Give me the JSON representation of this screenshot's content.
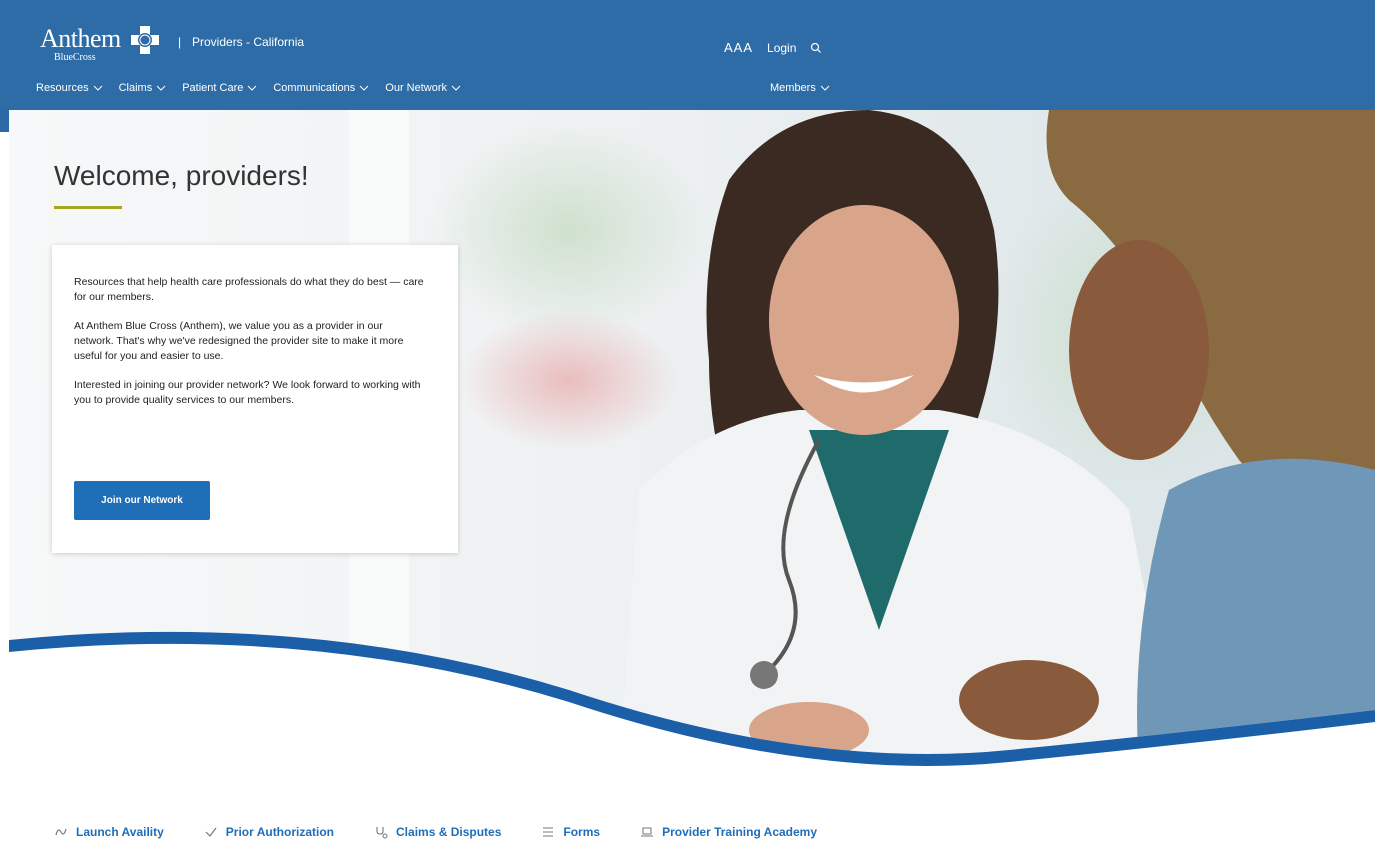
{
  "header": {
    "logo_word": "Anthem",
    "logo_sub": "BlueCross",
    "separator": "|",
    "region": "Providers - California",
    "aaa": "AAA",
    "login": "Login"
  },
  "nav": {
    "items": [
      {
        "label": "Resources"
      },
      {
        "label": "Claims"
      },
      {
        "label": "Patient Care"
      },
      {
        "label": "Communications"
      },
      {
        "label": "Our Network"
      }
    ],
    "members": "Members"
  },
  "hero": {
    "title": "Welcome, providers!",
    "paragraphs": [
      "Resources that help health care professionals do what they do best — care for our members.",
      "At Anthem Blue Cross (Anthem), we value you as a provider in our network. That's why we've redesigned the provider site to make it more useful for you and easier to use.",
      "Interested in joining our provider network? We look forward to working with you to provide quality services to our members."
    ],
    "cta": "Join our Network"
  },
  "quick_links": [
    {
      "label": "Launch Availity",
      "icon": "availity-icon"
    },
    {
      "label": "Prior Authorization",
      "icon": "checkmark-icon"
    },
    {
      "label": "Claims & Disputes",
      "icon": "stethoscope-icon"
    },
    {
      "label": "Forms",
      "icon": "list-icon"
    },
    {
      "label": "Provider Training Academy",
      "icon": "laptop-icon"
    }
  ],
  "colors": {
    "header": "#2e6ca8",
    "accent": "#a7a61f",
    "link": "#1e6eb8",
    "wave": "#1a5fa8"
  }
}
